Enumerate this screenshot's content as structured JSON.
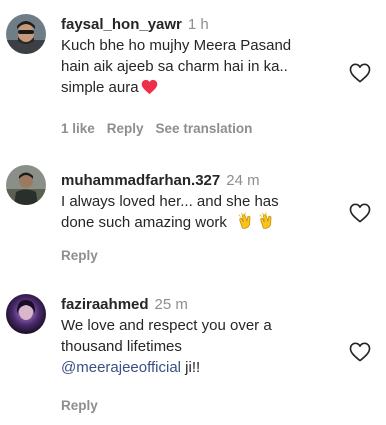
{
  "comments": [
    {
      "username": "faysal_hon_yawr",
      "time": "1 h",
      "text_lines": [
        "Kuch bhe ho mujhy Meera Pasand",
        "hain aik ajeeb sa charm hai in ka..",
        "simple aura"
      ],
      "likes": "1 like",
      "reply": "Reply",
      "translation": "See translation"
    },
    {
      "username": "muhammadfarhan.327",
      "time": "24 m",
      "text_lines": [
        "I always loved her... and she has",
        "done such amazing work"
      ],
      "reply": "Reply"
    },
    {
      "username": "faziraahmed",
      "time": "25 m",
      "text_lines": [
        "We love and respect you over a",
        "thousand lifetimes"
      ],
      "mention": "@meerajeeofficial",
      "mention_suffix": " ji!!",
      "reply": "Reply"
    }
  ],
  "icons": {
    "like": "heart-outline-icon",
    "heart_emoji": "red-heart-emoji",
    "clap_emoji": "clapping-hands-emoji"
  },
  "colors": {
    "text": "#262626",
    "secondary": "#8e8e8e",
    "mention": "#385185",
    "heart": "#ed2f4a"
  }
}
